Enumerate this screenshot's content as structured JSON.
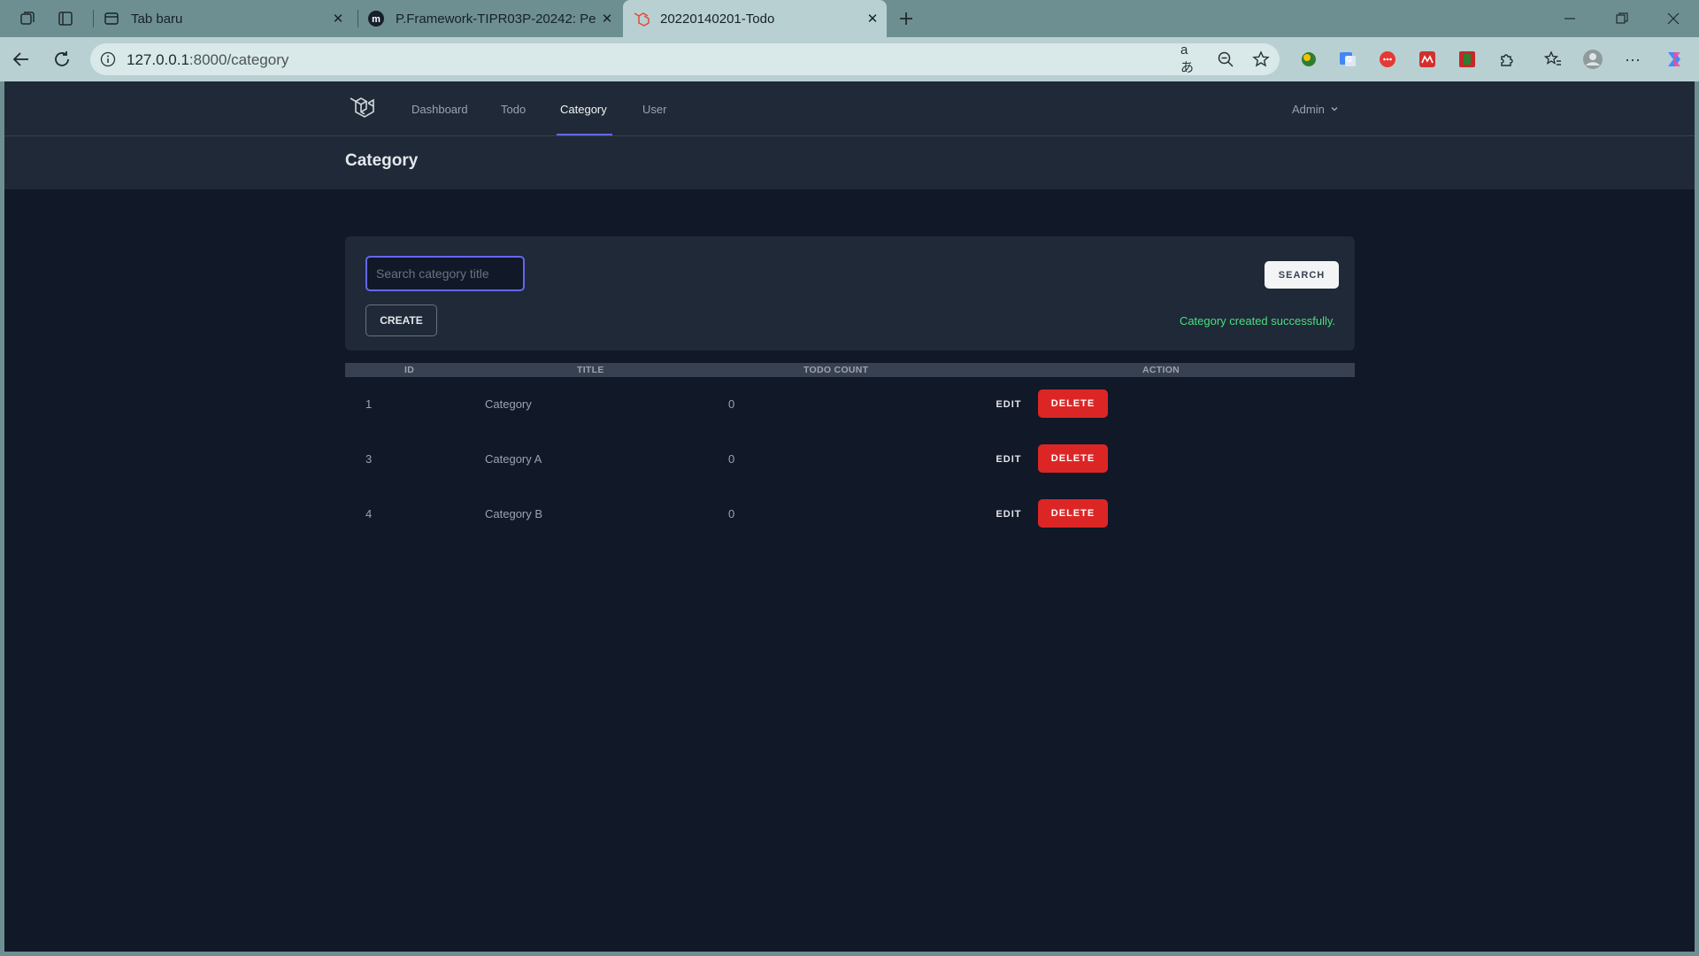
{
  "browser": {
    "tabs": [
      {
        "title": "Tab baru",
        "favicon": "newtab-icon"
      },
      {
        "title": "P.Framework-TIPR03P-20242: Per",
        "favicon": "moodle-icon"
      },
      {
        "title": "20220140201-Todo",
        "favicon": "laravel-icon"
      }
    ],
    "url_host": "127.0.0.1",
    "url_path": ":8000/category"
  },
  "nav": {
    "links": [
      "Dashboard",
      "Todo",
      "Category",
      "User"
    ],
    "active": "Category",
    "user": "Admin"
  },
  "page": {
    "title": "Category"
  },
  "controls": {
    "search_placeholder": "Search category title",
    "search_label": "SEARCH",
    "create_label": "CREATE",
    "flash_message": "Category created successfully."
  },
  "table": {
    "headers": [
      "ID",
      "TITLE",
      "TODO COUNT",
      "ACTION"
    ],
    "rows": [
      {
        "id": "1",
        "title": "Category",
        "todo_count": "0"
      },
      {
        "id": "3",
        "title": "Category A",
        "todo_count": "0"
      },
      {
        "id": "4",
        "title": "Category B",
        "todo_count": "0"
      }
    ],
    "edit_label": "EDIT",
    "delete_label": "DELETE"
  },
  "colors": {
    "accent": "#6366f1",
    "danger": "#dc2626",
    "success": "#4ade80",
    "page_bg": "#111827",
    "panel_bg": "#1f2937"
  }
}
